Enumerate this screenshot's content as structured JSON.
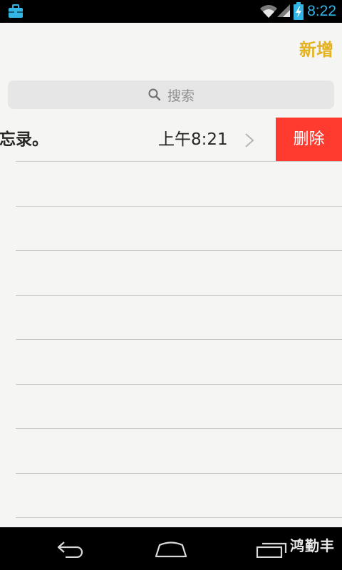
{
  "status_bar": {
    "time": "8:22",
    "icons": [
      "briefcase-icon",
      "wifi-icon",
      "signal-icon",
      "battery-charging-icon"
    ],
    "accent_color": "#33b5e5"
  },
  "toolbar": {
    "add_label": "新增",
    "add_color": "#e4b21f"
  },
  "search": {
    "placeholder": "搜索",
    "icon": "search-icon"
  },
  "notes": [
    {
      "title": "备忘录。",
      "time": "上午8:21",
      "delete_label": "删除"
    }
  ],
  "colors": {
    "delete": "#ff3b30",
    "paper": "#f5f5f3"
  },
  "nav_bar": {
    "buttons": [
      "back-icon",
      "home-icon",
      "recents-icon"
    ],
    "watermark": "鸿勤丰"
  }
}
